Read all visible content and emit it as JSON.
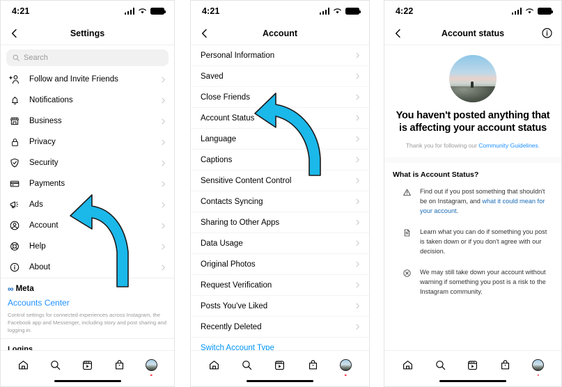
{
  "panel1": {
    "status": {
      "time": "4:21",
      "signal_icon": "cellular-bars-icon",
      "wifi_icon": "wifi-icon",
      "battery_icon": "battery-icon"
    },
    "nav": {
      "back_icon": "back-chevron-icon",
      "title": "Settings"
    },
    "search": {
      "placeholder": "Search",
      "icon": "search-icon"
    },
    "items": [
      {
        "label": "Follow and Invite Friends",
        "icon": "add-person-icon"
      },
      {
        "label": "Notifications",
        "icon": "bell-icon"
      },
      {
        "label": "Business",
        "icon": "storefront-icon"
      },
      {
        "label": "Privacy",
        "icon": "lock-icon"
      },
      {
        "label": "Security",
        "icon": "shield-check-icon"
      },
      {
        "label": "Payments",
        "icon": "credit-card-icon"
      },
      {
        "label": "Ads",
        "icon": "megaphone-icon"
      },
      {
        "label": "Account",
        "icon": "person-circle-icon"
      },
      {
        "label": "Help",
        "icon": "lifebuoy-icon"
      },
      {
        "label": "About",
        "icon": "info-circle-icon"
      }
    ],
    "meta": {
      "brand_glyph": "∞",
      "brand_word": "Meta",
      "accounts_center": "Accounts Center",
      "description": "Control settings for connected experiences across Instagram, the Facebook app and Messenger, including story and post sharing and logging in."
    },
    "logins_title": "Logins"
  },
  "panel2": {
    "status": {
      "time": "4:21"
    },
    "nav": {
      "title": "Account"
    },
    "items": [
      {
        "label": "Personal Information",
        "type": "chevron"
      },
      {
        "label": "Saved",
        "type": "chevron"
      },
      {
        "label": "Close Friends",
        "type": "chevron"
      },
      {
        "label": "Account Status",
        "type": "chevron"
      },
      {
        "label": "Language",
        "type": "chevron"
      },
      {
        "label": "Captions",
        "type": "chevron"
      },
      {
        "label": "Sensitive Content Control",
        "type": "chevron"
      },
      {
        "label": "Contacts Syncing",
        "type": "chevron"
      },
      {
        "label": "Sharing to Other Apps",
        "type": "chevron"
      },
      {
        "label": "Data Usage",
        "type": "chevron"
      },
      {
        "label": "Original Photos",
        "type": "chevron"
      },
      {
        "label": "Request Verification",
        "type": "chevron"
      },
      {
        "label": "Posts You've Liked",
        "type": "chevron"
      },
      {
        "label": "Recently Deleted",
        "type": "chevron"
      },
      {
        "label": "Switch Account Type",
        "type": "link"
      }
    ]
  },
  "panel3": {
    "status": {
      "time": "4:22"
    },
    "nav": {
      "title": "Account status",
      "info_icon": "info-circle-icon"
    },
    "hero": {
      "avatar_icon": "profile-photo-avatar",
      "title": "You haven't posted anything that is affecting your account status",
      "subtitle_prefix": "Thank you for following our ",
      "subtitle_link": "Community Guidelines",
      "subtitle_suffix": "."
    },
    "section_title": "What is Account Status?",
    "bullets": [
      {
        "icon": "warning-triangle-icon",
        "text_before": "Find out if you post something that shouldn't be on Instagram, and ",
        "link": "what it could mean for your account",
        "text_after": "."
      },
      {
        "icon": "document-icon",
        "text_before": "Learn what you can do if something you post is taken down or if you don't agree with our decision.",
        "link": "",
        "text_after": ""
      },
      {
        "icon": "x-circle-icon",
        "text_before": "We may still take down your account without warning if something you post is a risk to the Instagram community.",
        "link": "",
        "text_after": ""
      }
    ]
  },
  "tabbar": {
    "items": [
      {
        "name": "home-icon"
      },
      {
        "name": "search-icon"
      },
      {
        "name": "reels-icon"
      },
      {
        "name": "shop-bag-icon"
      },
      {
        "name": "profile-avatar-icon"
      }
    ]
  },
  "annotations": {
    "arrow_color": "#1BB8EA",
    "arrow_outline": "#1a1a1a",
    "arrow1_target": "Account",
    "arrow2_target": "Account Status"
  }
}
